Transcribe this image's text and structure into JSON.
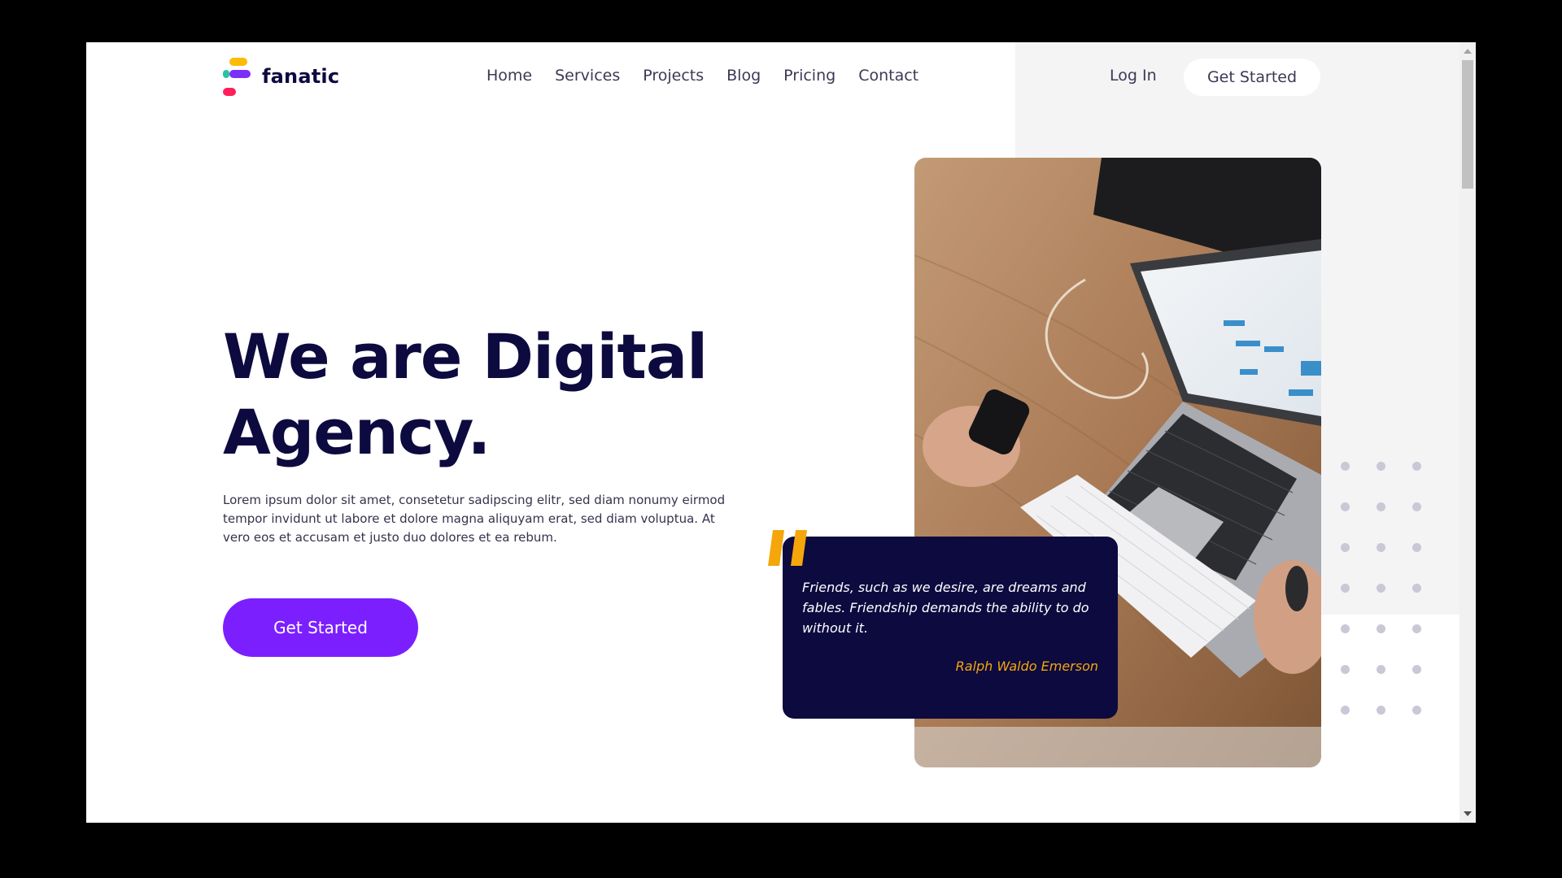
{
  "brand": {
    "name": "fanatic",
    "colors": {
      "yellow": "#fbbc05",
      "teal": "#2ac3a2",
      "purple": "#7b2ff7",
      "pink": "#ff1f5a",
      "navy": "#0d0a3f"
    }
  },
  "nav": {
    "items": [
      "Home",
      "Services",
      "Projects",
      "Blog",
      "Pricing",
      "Contact"
    ],
    "login_label": "Log In",
    "cta_label": "Get Started"
  },
  "hero": {
    "title_line1": "We are Digital",
    "title_line2": "Agency.",
    "description": "Lorem ipsum dolor sit amet, consetetur sadipscing elitr, sed diam nonumy eirmod tempor invidunt ut labore et dolore magna aliquyam erat, sed diam voluptua. At vero eos et accusam et justo duo dolores et ea rebum.",
    "cta_label": "Get Started",
    "cta_color": "#7b1fff"
  },
  "quote": {
    "text": "Friends, such as we desire, are dreams and fables. Friendship demands the ability to do without it.",
    "author": "Ralph Waldo Emerson",
    "accent_color": "#f5a60b"
  },
  "photo": {
    "icon": "laptop-desk-photo"
  }
}
